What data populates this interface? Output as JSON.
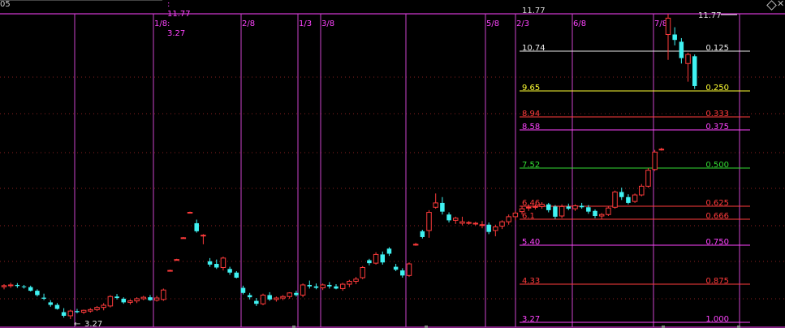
{
  "header": {
    "left_code": "05",
    "range_text": ": 11.77 : 3.27",
    "corner_icon": "diamond-icon"
  },
  "chart_data": {
    "type": "candlestick",
    "high": 11.77,
    "low": 3.27,
    "high_marker_label": "11.77",
    "low_marker_label": "3.27",
    "colors": {
      "up": "#ff3b3b",
      "down": "#3ff2f2",
      "fib_lines": "#ff44ff"
    },
    "fib_levels": [
      {
        "price": "11.77",
        "ratio": "",
        "color": "#d8d8d8"
      },
      {
        "price": "10.74",
        "ratio": "0.125",
        "color": "#e8e8e8"
      },
      {
        "price": "9.65",
        "ratio": "0.250",
        "color": "#ffff33"
      },
      {
        "price": "8.94",
        "ratio": "0.333",
        "color": "#ff3b3b"
      },
      {
        "price": "8.58",
        "ratio": "0.375",
        "color": "#ff44ff"
      },
      {
        "price": "7.52",
        "ratio": "0.500",
        "color": "#33dd33"
      },
      {
        "price": "6.46",
        "ratio": "0.625",
        "color": "#ff3b3b"
      },
      {
        "price": "6.1",
        "ratio": "0.666",
        "color": "#ff3b3b"
      },
      {
        "price": "5.40",
        "ratio": "0.750",
        "color": "#ff44ff"
      },
      {
        "price": "4.33",
        "ratio": "0.875",
        "color": "#ff3b3b"
      },
      {
        "price": "3.27",
        "ratio": "1.000",
        "color": "#ff44ff"
      }
    ],
    "time_labels": [
      "1/8",
      "2/8",
      "1/3",
      "3/8",
      "5/8",
      "2/3",
      "6/8",
      "7/8"
    ],
    "candles": [
      [
        4.25,
        4.32,
        4.18,
        4.28
      ],
      [
        4.28,
        4.36,
        4.22,
        4.3
      ],
      [
        4.3,
        4.35,
        4.22,
        4.27
      ],
      [
        4.26,
        4.3,
        4.2,
        4.24
      ],
      [
        4.24,
        4.28,
        4.12,
        4.14
      ],
      [
        4.14,
        4.18,
        3.98,
        4.02
      ],
      [
        3.95,
        4.06,
        3.88,
        3.92
      ],
      [
        3.82,
        3.88,
        3.7,
        3.75
      ],
      [
        3.75,
        3.8,
        3.62,
        3.64
      ],
      [
        3.55,
        3.66,
        3.4,
        3.45
      ],
      [
        3.45,
        3.62,
        3.36,
        3.58
      ],
      [
        3.58,
        3.64,
        3.52,
        3.55
      ],
      [
        3.55,
        3.62,
        3.5,
        3.6
      ],
      [
        3.58,
        3.66,
        3.54,
        3.62
      ],
      [
        3.62,
        3.72,
        3.58,
        3.68
      ],
      [
        3.68,
        3.8,
        3.6,
        3.74
      ],
      [
        3.72,
        4.02,
        3.68,
        3.98
      ],
      [
        3.98,
        4.05,
        3.9,
        3.94
      ],
      [
        3.92,
        3.96,
        3.78,
        3.82
      ],
      [
        3.82,
        3.9,
        3.76,
        3.86
      ],
      [
        3.86,
        3.96,
        3.8,
        3.92
      ],
      [
        3.92,
        4.0,
        3.88,
        3.96
      ],
      [
        3.96,
        4.02,
        3.86,
        3.88
      ],
      [
        3.88,
        4.0,
        3.84,
        3.94
      ],
      [
        3.9,
        4.2,
        3.86,
        4.16
      ],
      [
        4.7,
        4.72,
        4.68,
        4.7
      ],
      [
        5.0,
        5.02,
        4.98,
        5.0
      ],
      [
        5.6,
        5.62,
        5.58,
        5.6
      ],
      [
        6.3,
        6.32,
        6.28,
        6.3
      ],
      [
        6.0,
        6.1,
        5.74,
        5.78
      ],
      [
        5.65,
        5.7,
        5.42,
        5.67
      ],
      [
        4.95,
        5.04,
        4.8,
        4.86
      ],
      [
        4.88,
        5.0,
        4.74,
        4.78
      ],
      [
        4.78,
        5.08,
        4.7,
        5.04
      ],
      [
        4.74,
        4.8,
        4.58,
        4.64
      ],
      [
        4.64,
        4.68,
        4.48,
        4.5
      ],
      [
        4.22,
        4.28,
        4.04,
        4.08
      ],
      [
        4.02,
        4.08,
        3.9,
        3.96
      ],
      [
        3.86,
        3.94,
        3.72,
        3.78
      ],
      [
        3.78,
        4.06,
        3.74,
        4.02
      ],
      [
        4.02,
        4.1,
        3.86,
        3.9
      ],
      [
        3.9,
        3.98,
        3.84,
        3.94
      ],
      [
        3.94,
        4.02,
        3.88,
        3.98
      ],
      [
        3.98,
        4.1,
        3.92,
        4.08
      ],
      [
        4.08,
        4.14,
        3.98,
        4.02
      ],
      [
        4.02,
        4.34,
        3.96,
        4.3
      ],
      [
        4.3,
        4.42,
        4.2,
        4.26
      ],
      [
        4.26,
        4.34,
        4.18,
        4.22
      ],
      [
        4.22,
        4.34,
        4.16,
        4.3
      ],
      [
        4.3,
        4.38,
        4.2,
        4.26
      ],
      [
        4.26,
        4.32,
        4.18,
        4.2
      ],
      [
        4.2,
        4.36,
        4.14,
        4.32
      ],
      [
        4.32,
        4.44,
        4.24,
        4.4
      ],
      [
        4.4,
        4.52,
        4.32,
        4.46
      ],
      [
        4.5,
        4.82,
        4.46,
        4.78
      ],
      [
        4.98,
        5.02,
        4.84,
        4.9
      ],
      [
        4.9,
        5.2,
        4.86,
        5.14
      ],
      [
        5.14,
        5.22,
        4.86,
        4.92
      ],
      [
        5.3,
        5.34,
        5.1,
        5.16
      ],
      [
        4.8,
        4.88,
        4.68,
        4.72
      ],
      [
        4.7,
        4.76,
        4.5,
        4.56
      ],
      [
        4.56,
        4.92,
        4.52,
        4.88
      ],
      [
        5.42,
        5.46,
        5.38,
        5.42
      ],
      [
        5.78,
        5.82,
        5.58,
        5.62
      ],
      [
        5.8,
        6.36,
        5.6,
        6.3
      ],
      [
        6.44,
        6.82,
        6.4,
        6.56
      ],
      [
        6.56,
        6.72,
        6.24,
        6.32
      ],
      [
        6.24,
        6.3,
        6.02,
        6.08
      ],
      [
        6.08,
        6.18,
        5.98,
        6.14
      ],
      [
        6.0,
        6.18,
        5.94,
        6.04
      ],
      [
        6.0,
        6.06,
        5.96,
        6.02
      ],
      [
        6.0,
        6.04,
        5.94,
        6.0
      ],
      [
        5.96,
        6.06,
        5.86,
        5.96
      ],
      [
        5.96,
        6.02,
        5.7,
        5.76
      ],
      [
        5.8,
        5.96,
        5.64,
        5.9
      ],
      [
        5.92,
        6.08,
        5.84,
        6.04
      ],
      [
        6.04,
        6.24,
        5.96,
        6.18
      ],
      [
        6.18,
        6.34,
        6.08,
        6.28
      ],
      [
        6.32,
        6.46,
        6.24,
        6.4
      ],
      [
        6.42,
        6.52,
        6.34,
        6.44
      ],
      [
        6.44,
        6.52,
        6.38,
        6.46
      ],
      [
        6.46,
        6.58,
        6.4,
        6.52
      ],
      [
        6.52,
        6.56,
        6.3,
        6.36
      ],
      [
        6.46,
        6.5,
        6.12,
        6.18
      ],
      [
        6.2,
        6.52,
        6.14,
        6.46
      ],
      [
        6.46,
        6.54,
        6.36,
        6.4
      ],
      [
        6.4,
        6.52,
        6.34,
        6.48
      ],
      [
        6.48,
        6.56,
        6.4,
        6.44
      ],
      [
        6.44,
        6.5,
        6.26,
        6.32
      ],
      [
        6.34,
        6.38,
        6.14,
        6.2
      ],
      [
        6.2,
        6.28,
        6.12,
        6.24
      ],
      [
        6.24,
        6.46,
        6.2,
        6.42
      ],
      [
        6.44,
        6.9,
        6.4,
        6.86
      ],
      [
        6.86,
        6.98,
        6.64,
        6.72
      ],
      [
        6.72,
        6.8,
        6.52,
        6.56
      ],
      [
        6.6,
        6.82,
        6.56,
        6.78
      ],
      [
        6.78,
        7.08,
        6.74,
        7.02
      ],
      [
        7.02,
        7.52,
        6.98,
        7.46
      ],
      [
        7.48,
        8.02,
        7.44,
        7.96
      ],
      [
        8.02,
        8.08,
        8.0,
        8.04
      ],
      [
        11.2,
        11.77,
        10.5,
        11.65
      ],
      [
        11.2,
        11.4,
        10.9,
        11.05
      ],
      [
        11.0,
        11.1,
        10.4,
        10.55
      ],
      [
        10.4,
        10.7,
        9.9,
        10.65
      ],
      [
        10.6,
        10.65,
        9.7,
        9.78
      ]
    ]
  }
}
